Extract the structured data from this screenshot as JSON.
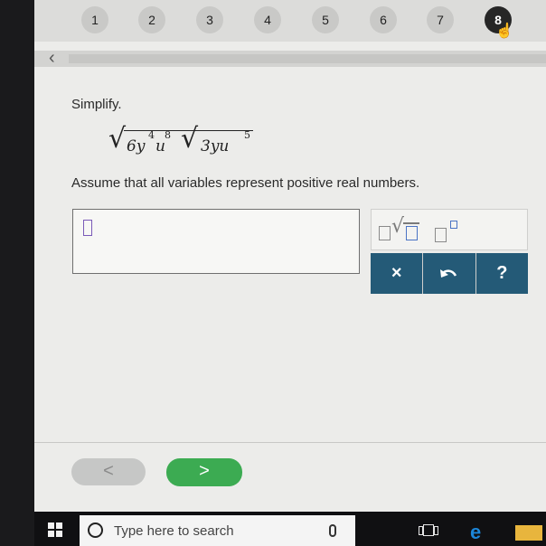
{
  "question_nav": {
    "items": [
      "1",
      "2",
      "3",
      "4",
      "5",
      "6",
      "7",
      "8"
    ],
    "current": "8"
  },
  "back_nav": {
    "icon": "chevron-left-icon"
  },
  "problem": {
    "instruction": "Simplify.",
    "expression": {
      "radicand1": {
        "coef": "6y",
        "exp1": "4",
        "var2": "u",
        "exp2": "8"
      },
      "radicand2": {
        "coef": "3yu",
        "exp": "5"
      }
    },
    "assumption": "Assume that all variables represent positive real numbers."
  },
  "answer": {
    "value": ""
  },
  "palette": {
    "tools": [
      "radical-with-coefficient-icon",
      "exponent-template-icon"
    ]
  },
  "actions": {
    "clear": "×",
    "undo_icon": "undo-icon",
    "help": "?"
  },
  "footer": {
    "prev": "<",
    "next": ">"
  },
  "taskbar": {
    "search_placeholder": "Type here to search"
  },
  "colors": {
    "action_bar": "#245a77",
    "next_button": "#3cab52",
    "prev_button": "#c6c7c6",
    "cursor": "#7a5ab8",
    "sqrt_box": "#4a73c4"
  }
}
